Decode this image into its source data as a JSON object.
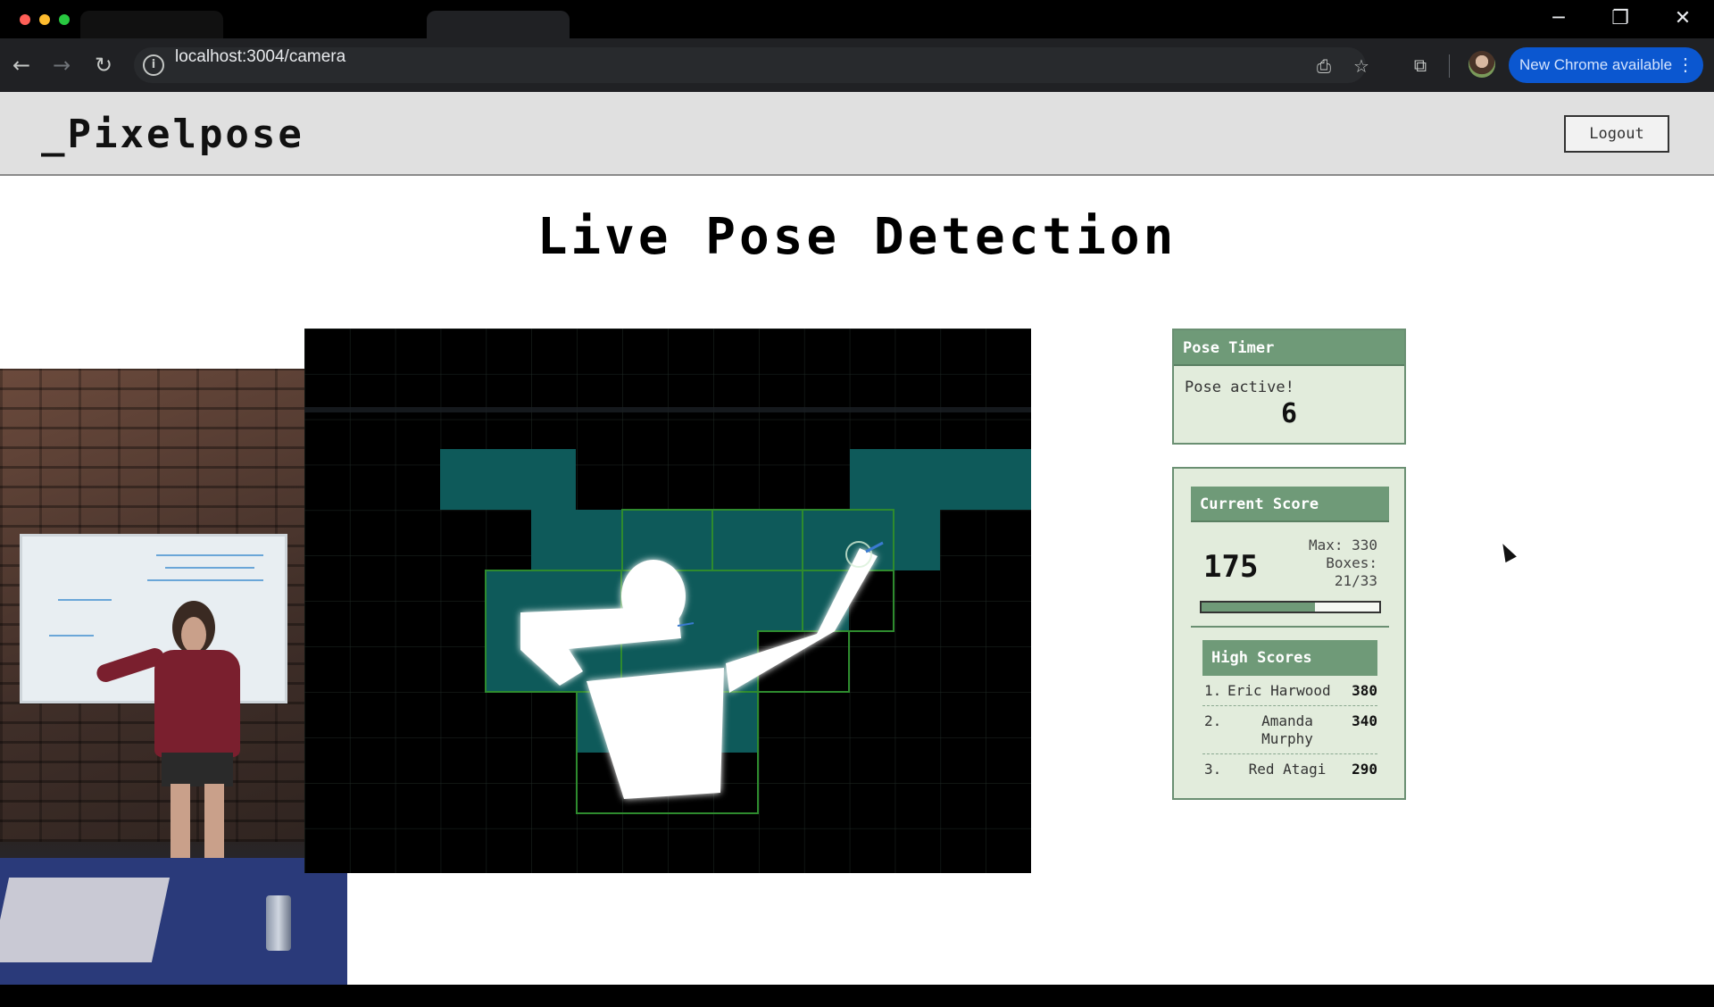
{
  "browser": {
    "url": "localhost:3004/camera",
    "update_label": "New Chrome available",
    "icons": [
      "back-icon",
      "forward-icon",
      "reload-icon",
      "site-info-icon",
      "install-icon",
      "bookmark-star-icon",
      "extensions-icon",
      "profile-avatar",
      "kebab-icon"
    ]
  },
  "header": {
    "logo": "_Pixelpose",
    "logout_label": "Logout"
  },
  "main": {
    "title": "Live Pose Detection"
  },
  "timer": {
    "heading": "Pose Timer",
    "status": "Pose active!",
    "count": "6"
  },
  "score": {
    "heading": "Current Score",
    "value": "175",
    "max_line": "Max: 330",
    "boxes_label": "Boxes:",
    "boxes_value": "21/33",
    "progress_fraction": 0.64
  },
  "high_scores": {
    "heading": "High Scores",
    "entries": [
      {
        "rank": "1.",
        "name": "Eric Harwood",
        "score": "380"
      },
      {
        "rank": "2.",
        "name": "Amanda Murphy",
        "score": "340"
      },
      {
        "rank": "3.",
        "name": "Red Atagi",
        "score": "290"
      }
    ]
  },
  "colors": {
    "panel_bg": "#e2ecdc",
    "panel_head": "#6f9a78",
    "target_fill": "#0e5a5a",
    "target_outline": "#2e8b2e",
    "chrome_accent": "#0b57d0"
  }
}
